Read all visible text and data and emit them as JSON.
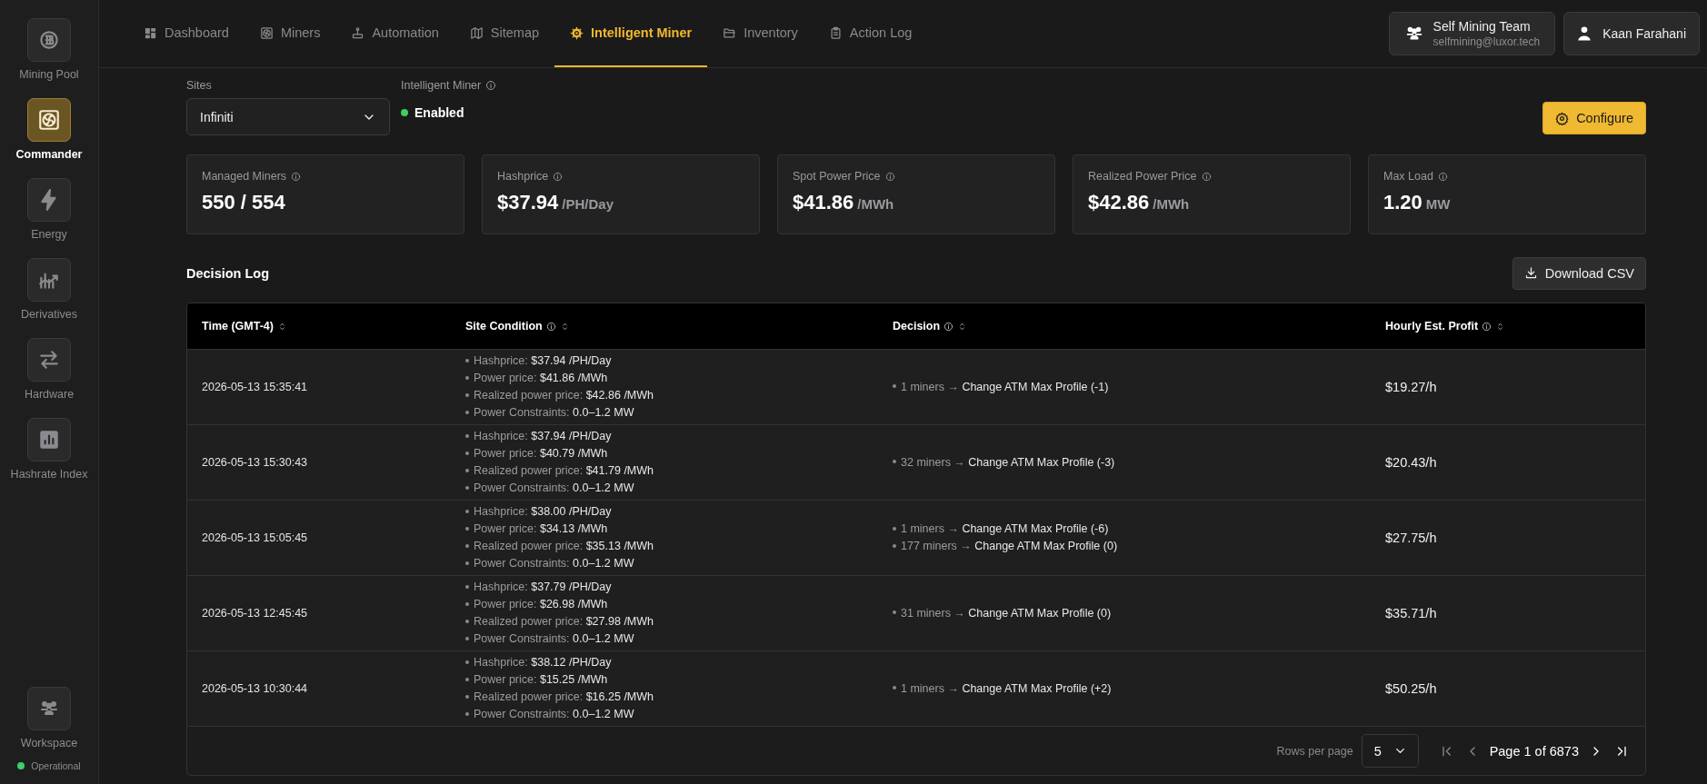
{
  "sidebar": {
    "items": [
      {
        "label": "Mining Pool",
        "selected": false
      },
      {
        "label": "Commander",
        "selected": true
      },
      {
        "label": "Energy",
        "selected": false
      },
      {
        "label": "Derivatives",
        "selected": false
      },
      {
        "label": "Hardware",
        "selected": false
      },
      {
        "label": "Hashrate Index",
        "selected": false
      }
    ],
    "workspace": {
      "label": "Workspace"
    },
    "status": {
      "label": "Operational",
      "color": "#3ccf6e"
    }
  },
  "nav": {
    "tabs": [
      {
        "label": "Dashboard",
        "selected": false
      },
      {
        "label": "Miners",
        "selected": false
      },
      {
        "label": "Automation",
        "selected": false
      },
      {
        "label": "Sitemap",
        "selected": false
      },
      {
        "label": "Intelligent Miner",
        "selected": true
      },
      {
        "label": "Inventory",
        "selected": false
      },
      {
        "label": "Action Log",
        "selected": false
      }
    ]
  },
  "account": {
    "team": "Self Mining Team",
    "email": "selfmining@luxor.tech",
    "user": "Kaan Farahani"
  },
  "filters": {
    "sites": {
      "label": "Sites",
      "value": "Infiniti"
    },
    "intelligent_miner": {
      "label": "Intelligent Miner",
      "status": "Enabled",
      "enabled": true
    }
  },
  "configure_button": "Configure",
  "stats": [
    {
      "label": "Managed Miners",
      "value": "550 / 554"
    },
    {
      "label": "Hashprice",
      "value": "$37.94",
      "unit": "/PH/Day"
    },
    {
      "label": "Spot Power Price",
      "value": "$41.86",
      "unit": "/MWh"
    },
    {
      "label": "Realized Power Price",
      "value": "$42.86",
      "unit": "/MWh"
    },
    {
      "label": "Max Load",
      "value": "1.20",
      "unit": "MW"
    }
  ],
  "decision_log": {
    "title": "Decision Log",
    "download_button": "Download CSV",
    "columns": [
      {
        "label": "Time (GMT-4)",
        "info": false
      },
      {
        "label": "Site Condition",
        "info": true
      },
      {
        "label": "Decision",
        "info": true
      },
      {
        "label": "Hourly Est. Profit",
        "info": true
      }
    ],
    "rows": [
      {
        "time": "2026-05-13 15:35:41",
        "conditions": [
          {
            "label": "Hashprice:",
            "value": "$37.94 /PH/Day"
          },
          {
            "label": "Power price:",
            "value": "$41.86 /MWh"
          },
          {
            "label": "Realized power price:",
            "value": "$42.86 /MWh"
          },
          {
            "label": "Power Constraints:",
            "value": "0.0–1.2 MW"
          }
        ],
        "decisions": [
          {
            "count": "1 miners →",
            "action": "Change ATM Max Profile (-1)"
          }
        ],
        "profit": "$19.27/h"
      },
      {
        "time": "2026-05-13 15:30:43",
        "conditions": [
          {
            "label": "Hashprice:",
            "value": "$37.94 /PH/Day"
          },
          {
            "label": "Power price:",
            "value": "$40.79 /MWh"
          },
          {
            "label": "Realized power price:",
            "value": "$41.79 /MWh"
          },
          {
            "label": "Power Constraints:",
            "value": "0.0–1.2 MW"
          }
        ],
        "decisions": [
          {
            "count": "32 miners →",
            "action": "Change ATM Max Profile (-3)"
          }
        ],
        "profit": "$20.43/h"
      },
      {
        "time": "2026-05-13 15:05:45",
        "conditions": [
          {
            "label": "Hashprice:",
            "value": "$38.00 /PH/Day"
          },
          {
            "label": "Power price:",
            "value": "$34.13 /MWh"
          },
          {
            "label": "Realized power price:",
            "value": "$35.13 /MWh"
          },
          {
            "label": "Power Constraints:",
            "value": "0.0–1.2 MW"
          }
        ],
        "decisions": [
          {
            "count": "1 miners →",
            "action": "Change ATM Max Profile (-6)"
          },
          {
            "count": "177 miners →",
            "action": "Change ATM Max Profile (0)"
          }
        ],
        "profit": "$27.75/h"
      },
      {
        "time": "2026-05-13 12:45:45",
        "conditions": [
          {
            "label": "Hashprice:",
            "value": "$37.79 /PH/Day"
          },
          {
            "label": "Power price:",
            "value": "$26.98 /MWh"
          },
          {
            "label": "Realized power price:",
            "value": "$27.98 /MWh"
          },
          {
            "label": "Power Constraints:",
            "value": "0.0–1.2 MW"
          }
        ],
        "decisions": [
          {
            "count": "31 miners →",
            "action": "Change ATM Max Profile (0)"
          }
        ],
        "profit": "$35.71/h"
      },
      {
        "time": "2026-05-13 10:30:44",
        "conditions": [
          {
            "label": "Hashprice:",
            "value": "$38.12 /PH/Day"
          },
          {
            "label": "Power price:",
            "value": "$15.25 /MWh"
          },
          {
            "label": "Realized power price:",
            "value": "$16.25 /MWh"
          },
          {
            "label": "Power Constraints:",
            "value": "0.0–1.2 MW"
          }
        ],
        "decisions": [
          {
            "count": "1 miners →",
            "action": "Change ATM Max Profile (+2)"
          }
        ],
        "profit": "$50.25/h"
      }
    ]
  },
  "pagination": {
    "rows_label": "Rows per page",
    "rows_value": "5",
    "page_text": "Page 1 of 6873",
    "buttons": [
      {
        "kind": "first",
        "disabled": true
      },
      {
        "kind": "prev",
        "disabled": true
      },
      {
        "kind": "next",
        "disabled": false
      },
      {
        "kind": "last",
        "disabled": false
      }
    ]
  }
}
